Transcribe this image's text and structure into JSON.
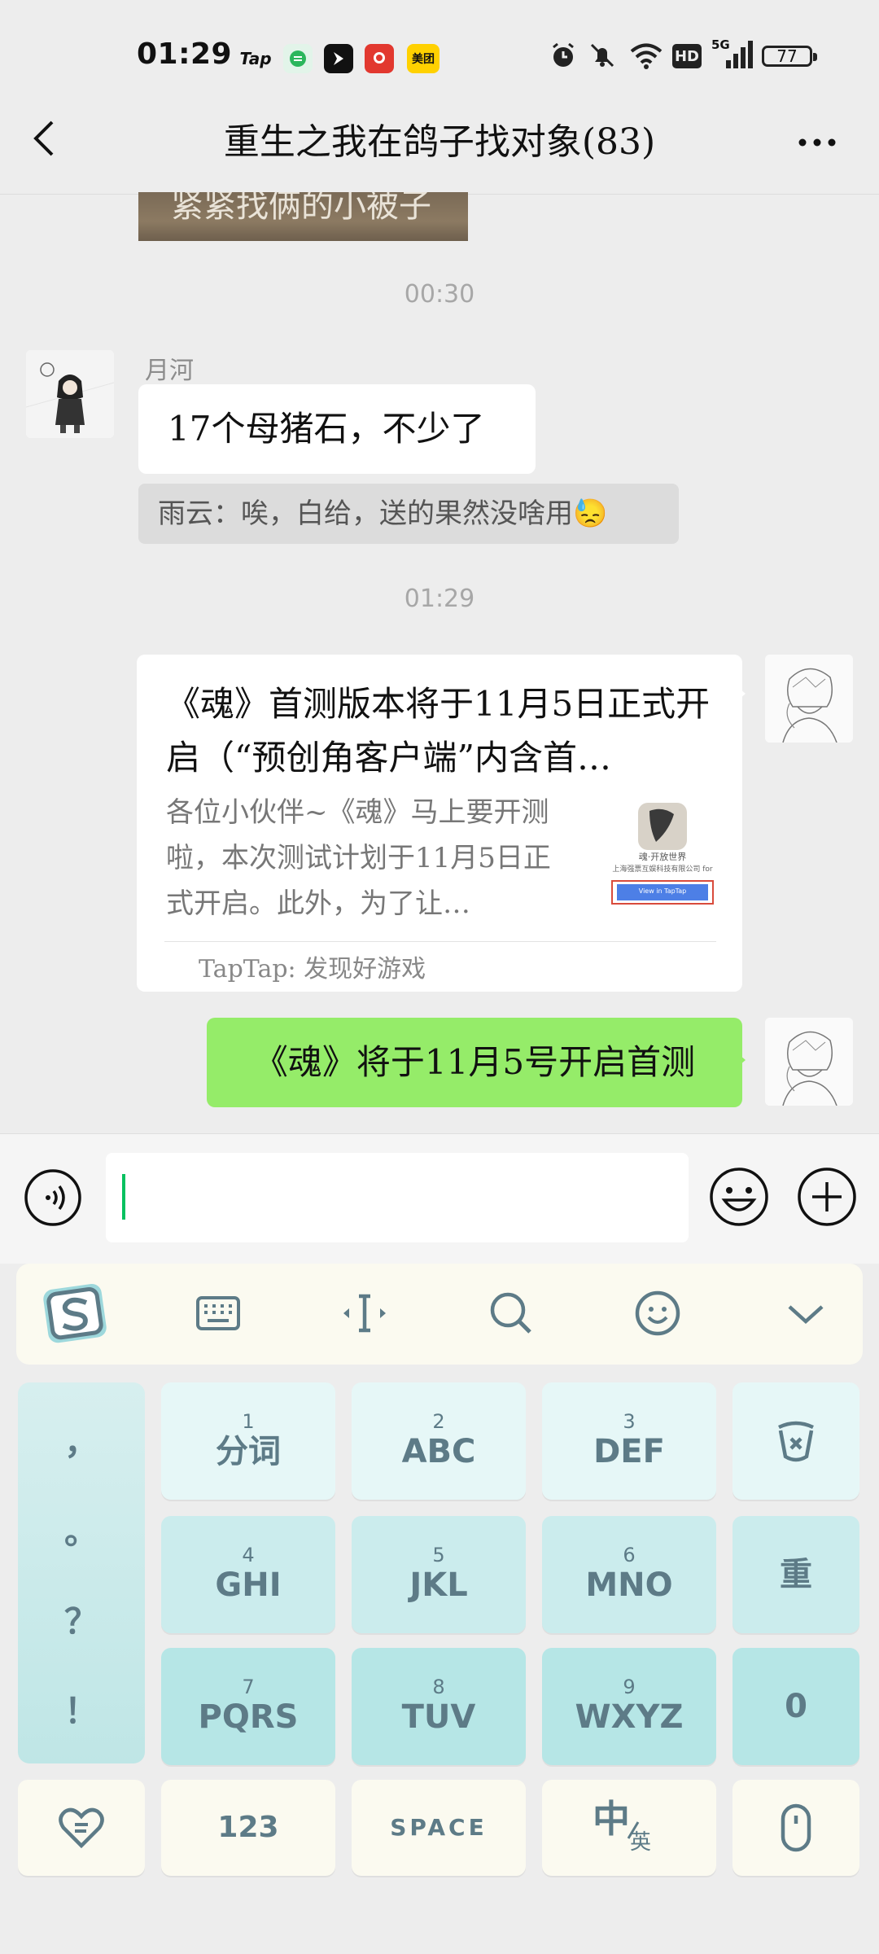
{
  "status_bar": {
    "time": "01:29",
    "apps": [
      "Tap",
      "美团"
    ],
    "network_label": "5G",
    "hd_label": "HD",
    "battery": "77"
  },
  "nav": {
    "title": "重生之我在鸽子找对象(83)"
  },
  "messages": {
    "image_fragment_text": "紧紧找俩的小被子",
    "time_1": "00:30",
    "sender_name": "月河",
    "msg1": "17个母猪石，不少了",
    "quote1": "雨云：唉，白给，送的果然没啥用😓",
    "time_2": "01:29",
    "card": {
      "title": "《魂》首测版本将于11月5日正式开启（“预创角客户端”内含首…",
      "desc": "各位小伙伴~《魂》马上要开测啦，本次测试计划于11月5日正式开启。此外，为了让…",
      "source": "TapTap: 发现好游戏",
      "thumb_caption": "魂·开放世界",
      "thumb_company": "上海强票互娱科技有限公司 for",
      "thumb_button": "View in TapTap"
    },
    "msg2": "《魂》将于11月5号开启首测"
  },
  "keyboard": {
    "punct": [
      "，",
      "。",
      "？",
      "！"
    ],
    "row1": [
      {
        "num": "1",
        "label": "分词"
      },
      {
        "num": "2",
        "label": "ABC"
      },
      {
        "num": "3",
        "label": "DEF"
      }
    ],
    "row2": [
      {
        "num": "4",
        "label": "GHI"
      },
      {
        "num": "5",
        "label": "JKL"
      },
      {
        "num": "6",
        "label": "MNO"
      }
    ],
    "row3": [
      {
        "num": "7",
        "label": "PQRS"
      },
      {
        "num": "8",
        "label": "TUV"
      },
      {
        "num": "9",
        "label": "WXYZ"
      }
    ],
    "redo_label": "重",
    "zero_label": "0",
    "num_label": "123",
    "space_label": "SPACE",
    "lang_main": "中",
    "lang_sub": "英"
  },
  "colors": {
    "green_bubble": "#95ec69",
    "key_text": "#5d7b87",
    "caret": "#07c160"
  }
}
